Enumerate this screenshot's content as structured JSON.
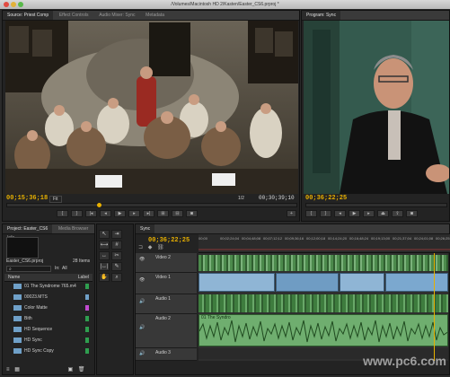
{
  "window": {
    "title": "/Volumes/Macintosh HD 2/Kasten/Easter_CS6.prproj *"
  },
  "source_monitor": {
    "tabs": [
      "Source: Priest Comp",
      "Effect Controls",
      "Audio Mixer: Sync",
      "Metadata"
    ],
    "timecode_in": "00;15;36;18",
    "zoom": "Fit",
    "fraction": "1/2",
    "timecode_out": "00;30;39;10"
  },
  "program_monitor": {
    "tabs": [
      "Program: Sync"
    ],
    "timecode_in": "00;36;22;25"
  },
  "project_panel": {
    "tabs": [
      "Project: Easter_CS6",
      "Media Browser",
      "Info"
    ],
    "project_file": "Easter_CS6.prproj",
    "item_count": "28 Items",
    "in_label": "In:",
    "in_value": "All",
    "column_name": "Name",
    "column_label": "Label",
    "items": [
      {
        "name": "01 The Syndrome 765.m4",
        "color": "#2f9e4f"
      },
      {
        "name": "00023.MTS",
        "color": "#6fa0c8"
      },
      {
        "name": "Color Matte",
        "color": "#c24ad0"
      },
      {
        "name": "Bith",
        "color": "#2f9e4f"
      },
      {
        "name": "HD Sequence",
        "color": "#2f9e4f"
      },
      {
        "name": "HD Sync",
        "color": "#2f9e4f"
      },
      {
        "name": "HD Sync Copy",
        "color": "#2f9e4f"
      }
    ]
  },
  "timeline": {
    "tabs": [
      "Sync"
    ],
    "timecode": "00;36;22;25",
    "ruler": [
      "00;00",
      "00;02;24;04",
      "00;04;48;08",
      "00;07;12;12",
      "00;09;36;16",
      "00;12;00;18",
      "00;14;24;20",
      "00;16;48;24",
      "00;19;13;00",
      "00;21;37;04",
      "00;24;01;08",
      "00;26;25;10"
    ],
    "tracks": [
      {
        "id": "V2",
        "label": "Video 2"
      },
      {
        "id": "V1",
        "label": "Video 1"
      },
      {
        "id": "A1",
        "label": "Audio 1"
      },
      {
        "id": "A2",
        "label": "Audio 2"
      },
      {
        "id": "A3",
        "label": "Audio 3"
      }
    ],
    "clip_label": "01 The Syndro"
  },
  "tools": [
    "selection",
    "track-select",
    "ripple",
    "rolling",
    "rate",
    "razor",
    "slip",
    "slide",
    "pen",
    "hand",
    "zoom"
  ],
  "watermark": "www.pc6.com"
}
